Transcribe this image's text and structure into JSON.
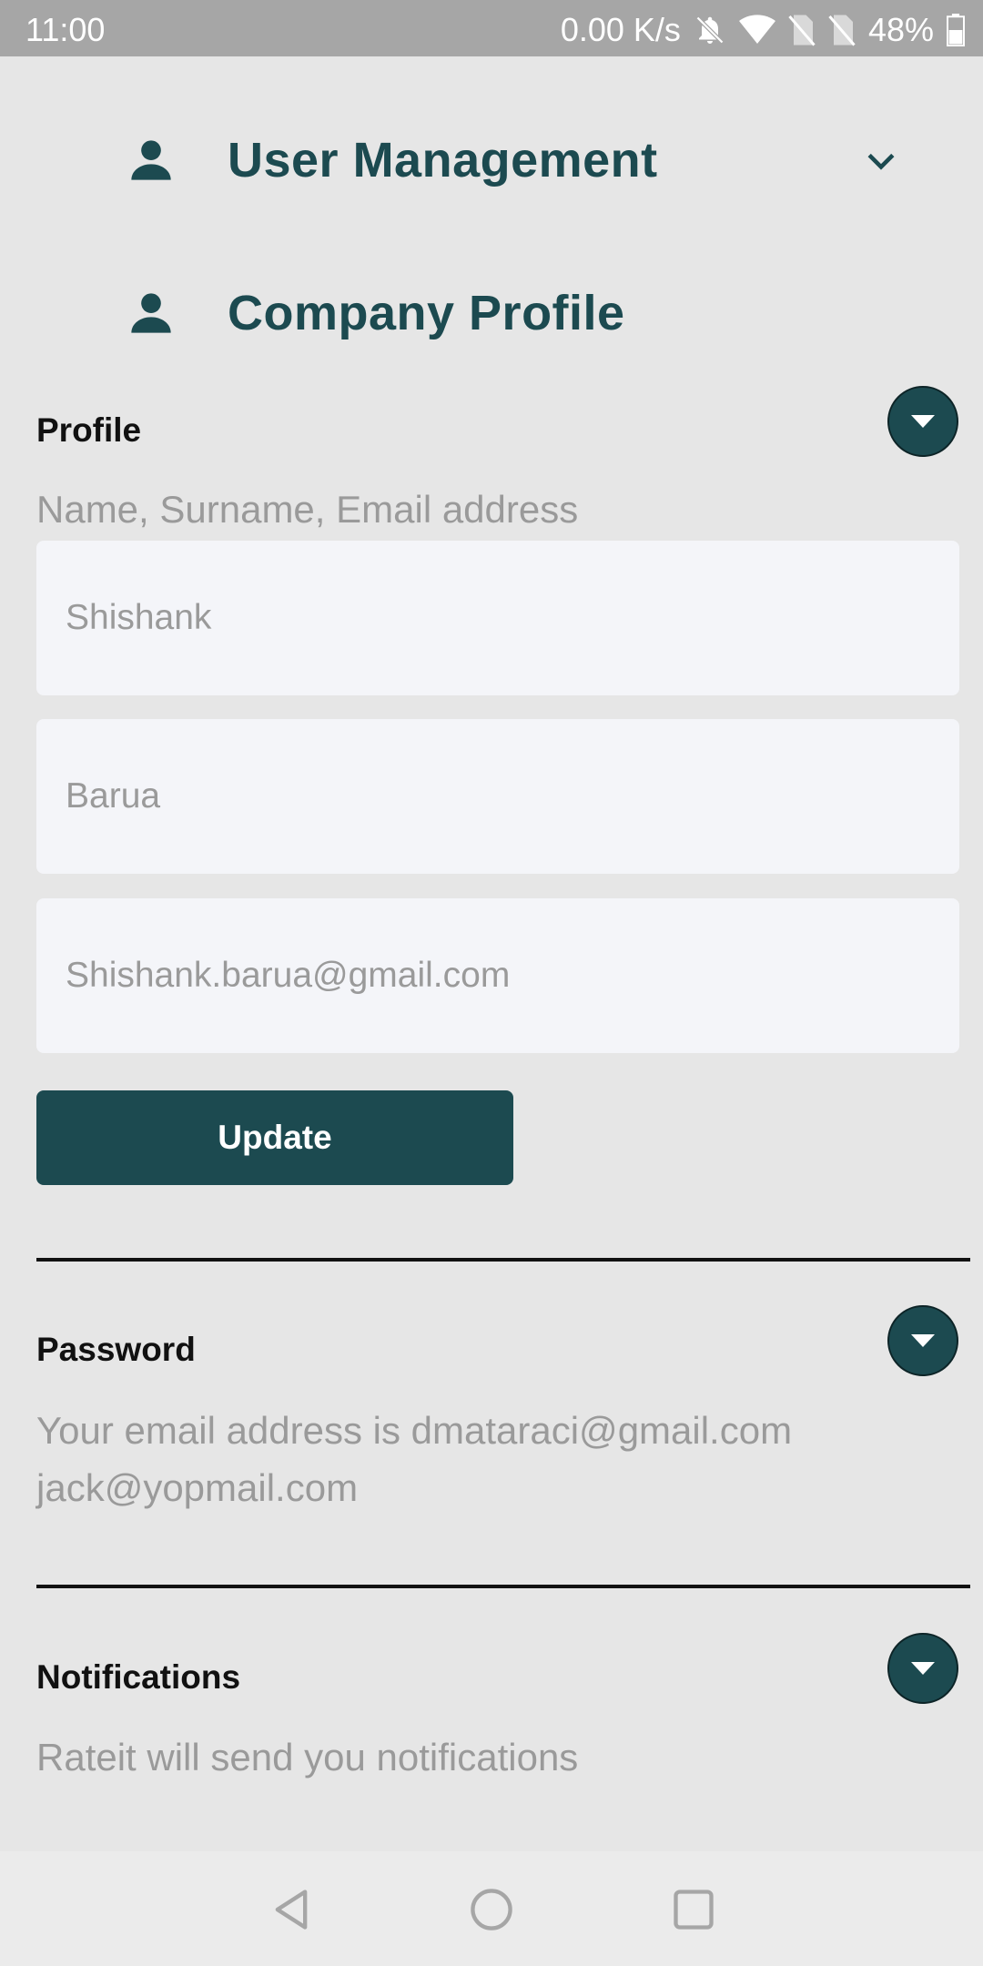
{
  "status_bar": {
    "time": "11:00",
    "speed": "0.00 K/s",
    "battery": "48%",
    "icons": [
      "bell-off-icon",
      "wifi-icon",
      "no-sim-icon",
      "no-sim-icon",
      "battery-icon"
    ]
  },
  "menu": {
    "user_management": {
      "label": "User Management",
      "icon": "person-icon",
      "chevron": "chevron-down-icon"
    },
    "company_profile": {
      "label": "Company Profile",
      "icon": "person-icon"
    }
  },
  "profile": {
    "title": "Profile",
    "hint": "Name, Surname, Email address",
    "first_name": "Shishank",
    "last_name": "Barua",
    "email": "Shishank.barua@gmail.com",
    "update_label": "Update"
  },
  "password": {
    "title": "Password",
    "line1": "Your email address is dmataraci@gmail.com",
    "line2": "jack@yopmail.com"
  },
  "notifications": {
    "title": "Notifications",
    "description": "Rateit will send you notifications"
  },
  "colors": {
    "accent": "#1c4a50",
    "background": "#e6e6e6",
    "field_bg": "#f4f5f9",
    "muted_text": "#9a9a9a"
  }
}
